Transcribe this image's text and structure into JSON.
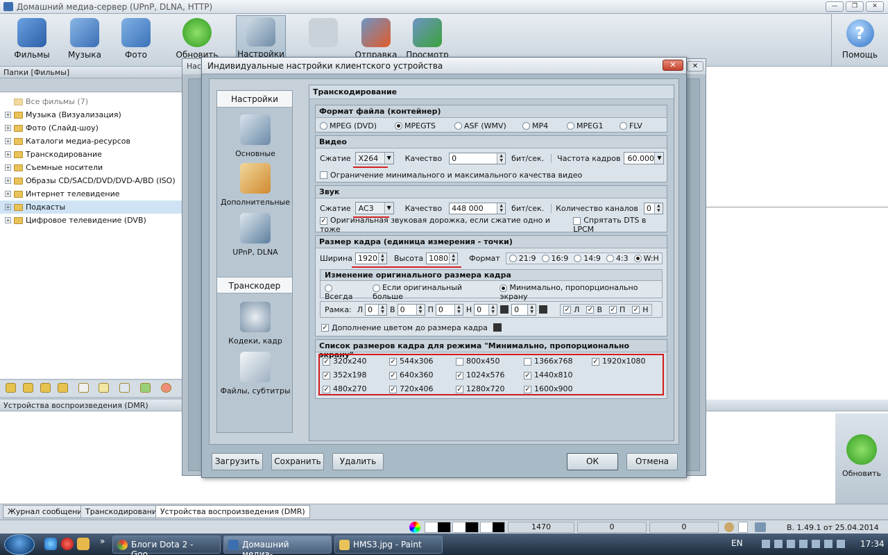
{
  "app": {
    "title": "Домашний медиа-сервер (UPnP, DLNA, HTTP)",
    "toolbar": [
      {
        "label": "Фильмы",
        "icon": "film-icon"
      },
      {
        "label": "Музыка",
        "icon": "music-icon"
      },
      {
        "label": "Фото",
        "icon": "photo-icon"
      },
      {
        "label": "Обновить",
        "icon": "refresh-icon"
      },
      {
        "label": "Настройки",
        "icon": "settings-icon"
      },
      {
        "label": "",
        "icon": "disabled-icon"
      },
      {
        "label": "Отправка",
        "icon": "send-icon"
      },
      {
        "label": "Просмотр",
        "icon": "view-icon"
      }
    ],
    "help_label": "Помощь",
    "folders_header": "Папки [Фильмы]",
    "tree": [
      {
        "label": "Все фильмы (7)"
      },
      {
        "label": "Музыка (Визуализация)"
      },
      {
        "label": "Фото (Слайд-шоу)"
      },
      {
        "label": "Каталоги медиа-ресурсов"
      },
      {
        "label": "Транскодирование"
      },
      {
        "label": "Съемные носители"
      },
      {
        "label": "Образы CD/SACD/DVD/DVD-A/BD (ISO)"
      },
      {
        "label": "Интернет телевидение"
      },
      {
        "label": "Подкасты"
      },
      {
        "label": "Цифровое телевидение (DVB)"
      }
    ],
    "dmr_header": "Устройства воспроизведения (DMR)",
    "refresh_label": "Обновить",
    "tabs": [
      "Журнал сообщений",
      "Транскодирование",
      "Устройства воспроизведения (DMR)"
    ],
    "status": {
      "v1": "1470",
      "v2": "0",
      "v3": "0",
      "version": "В. 1.49.1 от 25.04.2014"
    }
  },
  "back_dialog": {
    "title_fragment": "Нас"
  },
  "dialog": {
    "title": "Индивидуальные настройки клиентского устройства",
    "close_glyph": "✕",
    "nav": {
      "settings_header": "Настройки",
      "items": [
        "Основные",
        "Дополнительные",
        "UPnP, DLNA"
      ],
      "transcoder_header": "Транскодер",
      "items2": [
        "Кодеки, кадр",
        "Файлы, субтитры"
      ]
    },
    "content_title": "Транскодирование",
    "format": {
      "header": "Формат файла (контейнер)",
      "options": [
        "MPEG (DVD)",
        "MPEGTS",
        "ASF (WMV)",
        "MP4",
        "MPEG1",
        "FLV"
      ],
      "selected": "MPEGTS"
    },
    "video": {
      "header": "Видео",
      "compress_label": "Сжатие",
      "compress_value": "X264",
      "quality_label": "Качество",
      "quality_value": "0",
      "unit": "бит/сек.",
      "fps_label": "Частота кадров",
      "fps_value": "60.000",
      "limit_label": "Ограничение минимального и максимального качества видео"
    },
    "audio": {
      "header": "Звук",
      "compress_label": "Сжатие",
      "compress_value": "AC3",
      "quality_label": "Качество",
      "quality_value": "448 000",
      "unit": "бит/сек.",
      "channels_label": "Количество каналов",
      "channels_value": "0",
      "orig_label": "Оригинальная звуковая дорожка, если сжатие одно и тоже",
      "dts_label": "Спрятать DTS в LPCM"
    },
    "frame": {
      "header": "Размер кадра (единица измерения - точки)",
      "width_label": "Ширина",
      "width_value": "1920",
      "height_label": "Высота",
      "height_value": "1080",
      "format_label": "Формат",
      "ratios": [
        "21:9",
        "16:9",
        "14:9",
        "4:3",
        "W:H"
      ],
      "ratio_selected": "W:H",
      "change_header": "Изменение оригинального размера кадра",
      "change_opts": [
        "Всегда",
        "Если оригинальный больше",
        "Минимально, пропорционально экрану"
      ],
      "change_selected": "Минимально, пропорционально экрану",
      "frame_label": "Рамка:",
      "border_labels": [
        "Л",
        "В",
        "П",
        "Н"
      ],
      "border_values": [
        "0",
        "0",
        "0",
        "0",
        "0"
      ],
      "check_labels": [
        "Л",
        "В",
        "П",
        "Н"
      ],
      "fill_label": "Дополнение цветом до размера кадра"
    },
    "sizes": {
      "header": "Список размеров кадра для режима \"Минимально, пропорционально экрану\"",
      "items": [
        {
          "label": "320x240",
          "checked": true
        },
        {
          "label": "544x306",
          "checked": true
        },
        {
          "label": "800x450",
          "checked": false
        },
        {
          "label": "1366x768",
          "checked": false
        },
        {
          "label": "1920x1080",
          "checked": true
        },
        {
          "label": "352x198",
          "checked": true
        },
        {
          "label": "640x360",
          "checked": true
        },
        {
          "label": "1024x576",
          "checked": true
        },
        {
          "label": "1440x810",
          "checked": true
        },
        {
          "label": "480x270",
          "checked": true
        },
        {
          "label": "720x406",
          "checked": true
        },
        {
          "label": "1280x720",
          "checked": true
        },
        {
          "label": "1600x900",
          "checked": true
        }
      ]
    },
    "buttons": {
      "load": "Загрузить",
      "save": "Сохранить",
      "delete": "Удалить",
      "ok": "ОК",
      "cancel": "Отмена"
    }
  },
  "taskbar": {
    "tasks": [
      "Блоги Dota 2 - Goo...",
      "Домашний медиа-...",
      "HMS3.jpg - Paint"
    ],
    "lang": "EN",
    "time": "17:34"
  }
}
